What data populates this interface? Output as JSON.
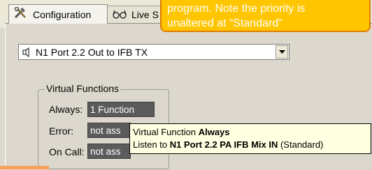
{
  "tabs": [
    {
      "label": "Configuration",
      "icon": "tools-icon",
      "active": true
    },
    {
      "label": "Live S",
      "icon": "glasses-icon",
      "active": false
    }
  ],
  "callout": {
    "line1": "program. Note the priority is",
    "line2": "unaltered at “Standard”"
  },
  "port_select": {
    "value": "N1 Port 2.2 Out to IFB TX",
    "icon": "speaker-icon"
  },
  "virtual_functions": {
    "title": "Virtual Functions",
    "rows": [
      {
        "label": "Always:",
        "value": "1 Function"
      },
      {
        "label": "Error:",
        "value": "not ass"
      },
      {
        "label": "On Call:",
        "value": "not ass"
      }
    ]
  },
  "tooltip": {
    "line1_prefix": "Virtual Function ",
    "line1_bold": "Always",
    "line2_prefix": "Listen to ",
    "line2_bold": "N1 Port 2.2 PA IFB Mix IN",
    "line2_suffix": " (Standard)"
  },
  "colors": {
    "callout_fill": "#ffc600",
    "callout_border": "#e07b00",
    "tooltip_bg": "#ffffe1",
    "field_bg": "#5b5b5b"
  }
}
